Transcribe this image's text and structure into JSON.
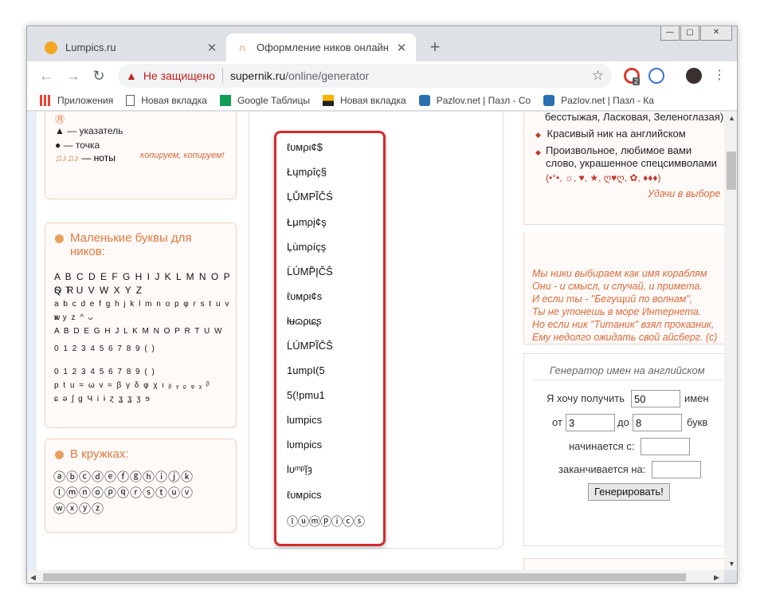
{
  "tabs": [
    {
      "title": "Lumpics.ru",
      "active": false
    },
    {
      "title": "Оформление ников онлайн",
      "active": true
    }
  ],
  "toolbar": {
    "security_label": "Не защищено",
    "url_host": "supernik.ru",
    "url_path": "/online/generator",
    "ext_badge": "2"
  },
  "bookmarks": [
    {
      "label": "Приложения",
      "icon": "apps-grid-icon"
    },
    {
      "label": "Новая вкладка",
      "icon": "page-icon"
    },
    {
      "label": "Google Таблицы",
      "icon": "sheets-icon"
    },
    {
      "label": "Новая вкладка",
      "icon": "image-icon"
    },
    {
      "label": "Pazlov.net | Пазл - Со",
      "icon": "puzzle-icon"
    },
    {
      "label": "Pazlov.net | Пазл - Ка",
      "icon": "puzzle-icon"
    }
  ],
  "left": {
    "symbols": {
      "pointer_label": "▲ — указатель",
      "dot_label": "● — точка",
      "notes_glyphs": "♫♪♫♪",
      "notes_label": "— ноты",
      "copy_label": "копируем, копируем!"
    },
    "small_letters": {
      "title": "Маленькие буквы для ников:",
      "lines": [
        "A B C D E F G H I J K L M N O P Q R",
        "S T U V W X Y Z",
        "a b c d e f g h j k l m n o p φ r s t u v w",
        "x y z ^ ᴗ",
        "A B D E G H J L K M N O P R T U W",
        "0 1 2 3 4 5 6 7 8 9 ( )",
        "",
        "0 1 2 3 4 5 6 7 8 9 ( )",
        "p t u = ω v ≈ β γ δ φ χ ι ᵦ ᵧ ᵨ ᵩ ᵪ ᵝ",
        "ɕ ə ʃ ɡ Ч i ɨ ɀ ʓ ʓ ʒ ɘ"
      ]
    },
    "circles": {
      "title": "В кружках:",
      "lines": [
        "ⓐⓑⓒⓓⓔⓕⓖⓗⓘⓙⓚ",
        "ⓛⓜⓝⓞⓟⓠⓡⓢⓣⓤⓥ",
        "ⓦⓧⓨⓩ"
      ]
    }
  },
  "nicks": [
    "ℓυмρι¢$",
    "Łųmρîç§",
    "ĻŮMPĨČŚ",
    "Łμmρį¢ş",
    "Ļùmρíçş",
    "ĹÚMP̃ĮČŜ",
    "ℓυмρι¢s",
    "łʉɷρɩɕʂ",
    "ĹÚMPĨČŠ",
    "1umpI(5",
    "5(!pmu1",
    "lumpics",
    "lυmρics",
    "lυᵐᵖĭ͎ȝ",
    "ℓυмρics",
    "ⓛⓤⓜⓟⓘⓒⓢ"
  ],
  "right": {
    "list_items": [
      "бесстыжая, Ласковая, Зеленоглазая)",
      "Красивый ник на английском",
      "Произвольное, любимое вами слово, украшенное спецсимволами"
    ],
    "symbols_line": "(•°•, ☼, ♥, ★, ღ♥ღ, ✿, ♦♦♦)",
    "luck": "Удачи в выборе",
    "poem": [
      "Мы ники выбираем как имя кораблям",
      "Они - и смысл, и случай, и примета.",
      "И если ты - \"Бегущий по волнам\",",
      "Ты не утонешь в море Интернета.",
      "Но если ник \"Титаник\" взял проказник,",
      "Ему недолго ожидать свой айсберг. (с)"
    ],
    "generator": {
      "title": "Генератор имен на английском",
      "want_label": "Я хочу получить",
      "want_value": "50",
      "names_label": "имен",
      "from_label": "от",
      "from_value": "3",
      "to_label": "до",
      "to_value": "8",
      "letters_label": "букв",
      "starts_label": "начинается с:",
      "starts_value": "",
      "ends_label": "заканчивается на:",
      "ends_value": "",
      "button": "Генерировать!"
    }
  },
  "colors": {
    "accent": "#e07a3c",
    "highlight_border": "#d42b2b",
    "link_red": "#c0392b"
  }
}
